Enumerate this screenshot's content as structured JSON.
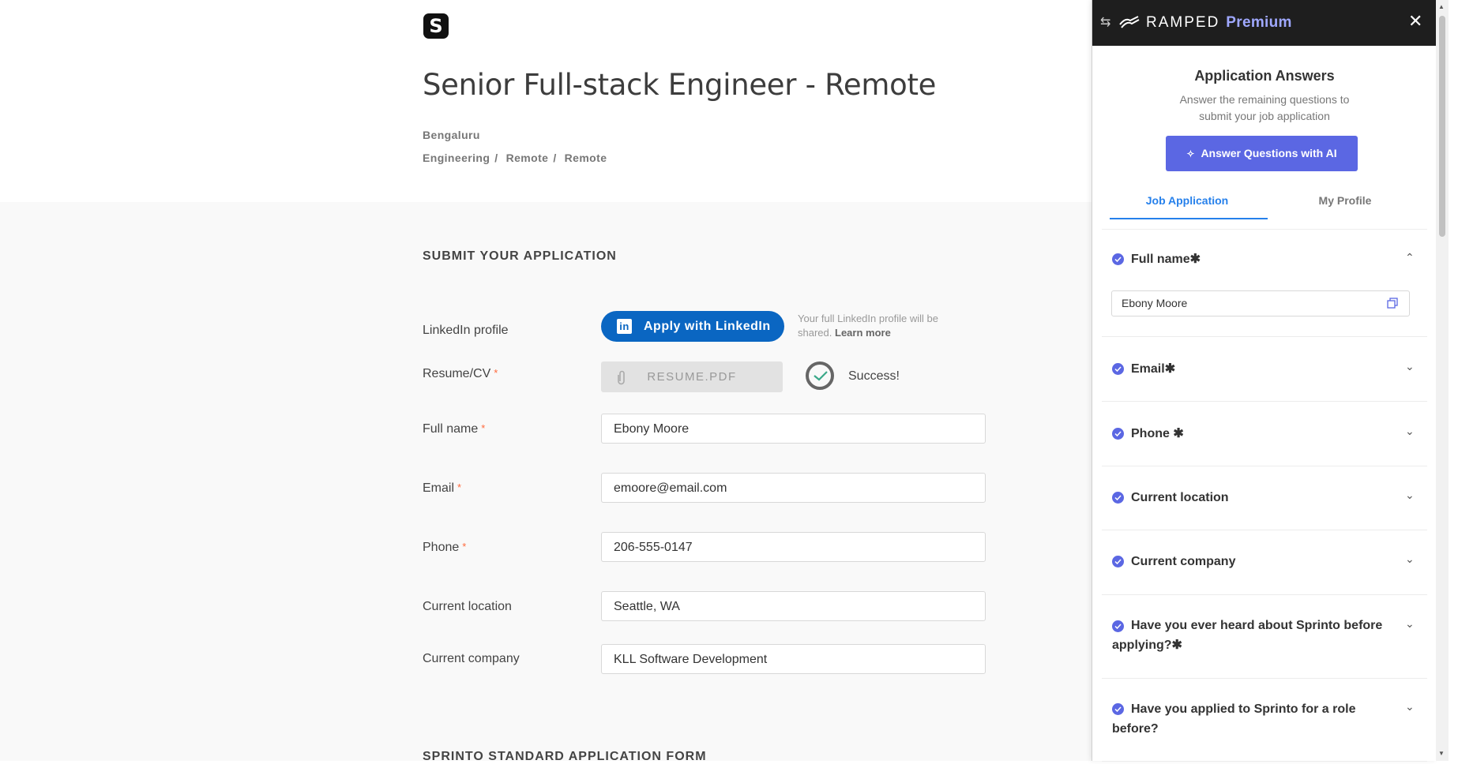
{
  "job": {
    "logo_letter": "S",
    "title": "Senior Full-stack Engineer - Remote",
    "location": "Bengaluru",
    "categories": [
      "Engineering",
      "Remote",
      "Remote"
    ],
    "category_sep": "/"
  },
  "form": {
    "section_title": "SUBMIT YOUR APPLICATION",
    "next_section_title": "SPRINTO STANDARD APPLICATION FORM",
    "required_mark": "*",
    "linkedin": {
      "label": "LinkedIn profile",
      "button": "Apply with LinkedIn",
      "icon_letter": "in",
      "note": "Your full LinkedIn profile will be shared.",
      "learn_more": "Learn more"
    },
    "resume": {
      "label": "Resume/CV",
      "button": "RESUME.PDF",
      "status": "Success!"
    },
    "fields": {
      "full_name": {
        "label": "Full name",
        "value": "Ebony Moore"
      },
      "email": {
        "label": "Email",
        "value": "emoore@email.com"
      },
      "phone": {
        "label": "Phone",
        "value": "206-555-0147"
      },
      "location": {
        "label": "Current location",
        "value": "Seattle, WA"
      },
      "company": {
        "label": "Current company",
        "value": "KLL Software Development"
      }
    }
  },
  "panel": {
    "brand": "RAMPED",
    "brand_tier": "Premium",
    "title": "Application Answers",
    "subtitle_line1": "Answer the remaining questions to",
    "subtitle_line2": "submit your job application",
    "ai_button": "Answer Questions with AI",
    "tabs": {
      "job": "Job Application",
      "profile": "My Profile"
    },
    "questions": [
      {
        "text": "Full name✱",
        "expanded": true,
        "answer": "Ebony Moore"
      },
      {
        "text": "Email✱",
        "expanded": false
      },
      {
        "text": "Phone ✱",
        "expanded": false
      },
      {
        "text": "Current location",
        "expanded": false
      },
      {
        "text": "Current company",
        "expanded": false
      },
      {
        "text": "Have you ever heard about Sprinto before applying?✱",
        "expanded": false
      },
      {
        "text": "Have you applied to Sprinto for a role before?",
        "expanded": false
      }
    ]
  },
  "colors": {
    "accent": "#5b67e3",
    "linkedin": "#0a66c2",
    "tab_active": "#2680eb",
    "required": "#ff6a3d"
  }
}
